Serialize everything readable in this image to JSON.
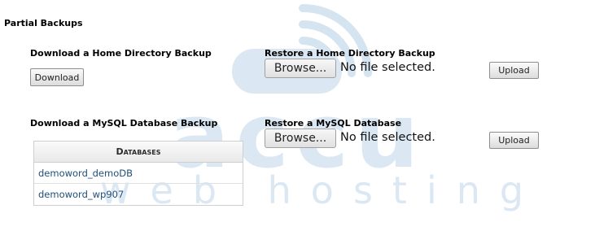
{
  "section_title": "Partial Backups",
  "home": {
    "download_heading": "Download a Home Directory Backup",
    "download_label": "Download",
    "restore_heading": "Restore a Home Directory Backup",
    "browse_label": "Browse...",
    "file_status": "No file selected.",
    "upload_label": "Upload"
  },
  "mysql": {
    "download_heading": "Download a MySQL Database Backup",
    "restore_heading": "Restore a MySQL Database",
    "browse_label": "Browse...",
    "file_status": "No file selected.",
    "upload_label": "Upload",
    "table_header": "Databases",
    "databases": [
      "demoword_demoDB",
      "demoword_wp907"
    ]
  },
  "watermark": {
    "brand": "accu",
    "tagline": "web hosting",
    "color": "#cfe0ee",
    "icon": "wifi-signal-icon"
  },
  "colors": {
    "link": "#1f4e79"
  }
}
